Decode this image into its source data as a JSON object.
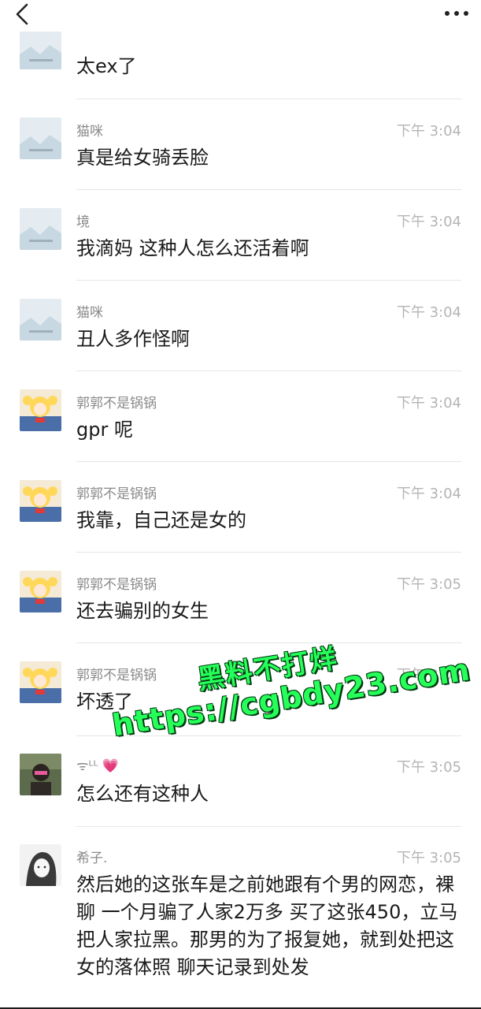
{
  "top": {
    "prev_message": "太ex了"
  },
  "messages": [
    {
      "avatar": "placeholder-image-avatar",
      "name": "猫咪",
      "time": "下午 3:04",
      "text": "真是给女骑丢脸"
    },
    {
      "avatar": "placeholder-image-avatar",
      "name": "境",
      "time": "下午 3:04",
      "text": "我滴妈 这种人怎么还活着啊"
    },
    {
      "avatar": "placeholder-image-avatar",
      "name": "猫咪",
      "time": "下午 3:04",
      "text": "丑人多作怪啊"
    },
    {
      "avatar": "anime-girl-avatar",
      "name": "郭郭不是锅锅",
      "time": "下午 3:04",
      "text": "gpr 呢"
    },
    {
      "avatar": "anime-girl-avatar",
      "name": "郭郭不是锅锅",
      "time": "下午 3:04",
      "text": "我靠，自己还是女的"
    },
    {
      "avatar": "anime-girl-avatar",
      "name": "郭郭不是锅锅",
      "time": "下午 3:05",
      "text": "还去骗别的女生"
    },
    {
      "avatar": "anime-girl-avatar",
      "name": "郭郭不是锅锅",
      "time": "下午 3:05",
      "text": "坏透了"
    },
    {
      "avatar": "photo-avatar",
      "name": "ᯤᴸᴸ 💗",
      "time": "下午 3:05",
      "text": "怎么还有这种人"
    },
    {
      "avatar": "sketch-avatar",
      "name": "希子.",
      "time": "下午 3:05",
      "text": "然后她的这张车是之前她跟有个男的网恋，裸聊 一个月骗了人家2万多 买了这张450，立马把人家拉黑。那男的为了报复她，就到处把这女的落体照 聊天记录到处发"
    }
  ],
  "watermark": {
    "line1": "黑料不打烊",
    "line2": "https://cgbdy23.com"
  },
  "colors": {
    "watermark": "#26ff59",
    "name": "#8a8a8a",
    "time": "#b4b4b4",
    "text": "#1a1a1a"
  }
}
